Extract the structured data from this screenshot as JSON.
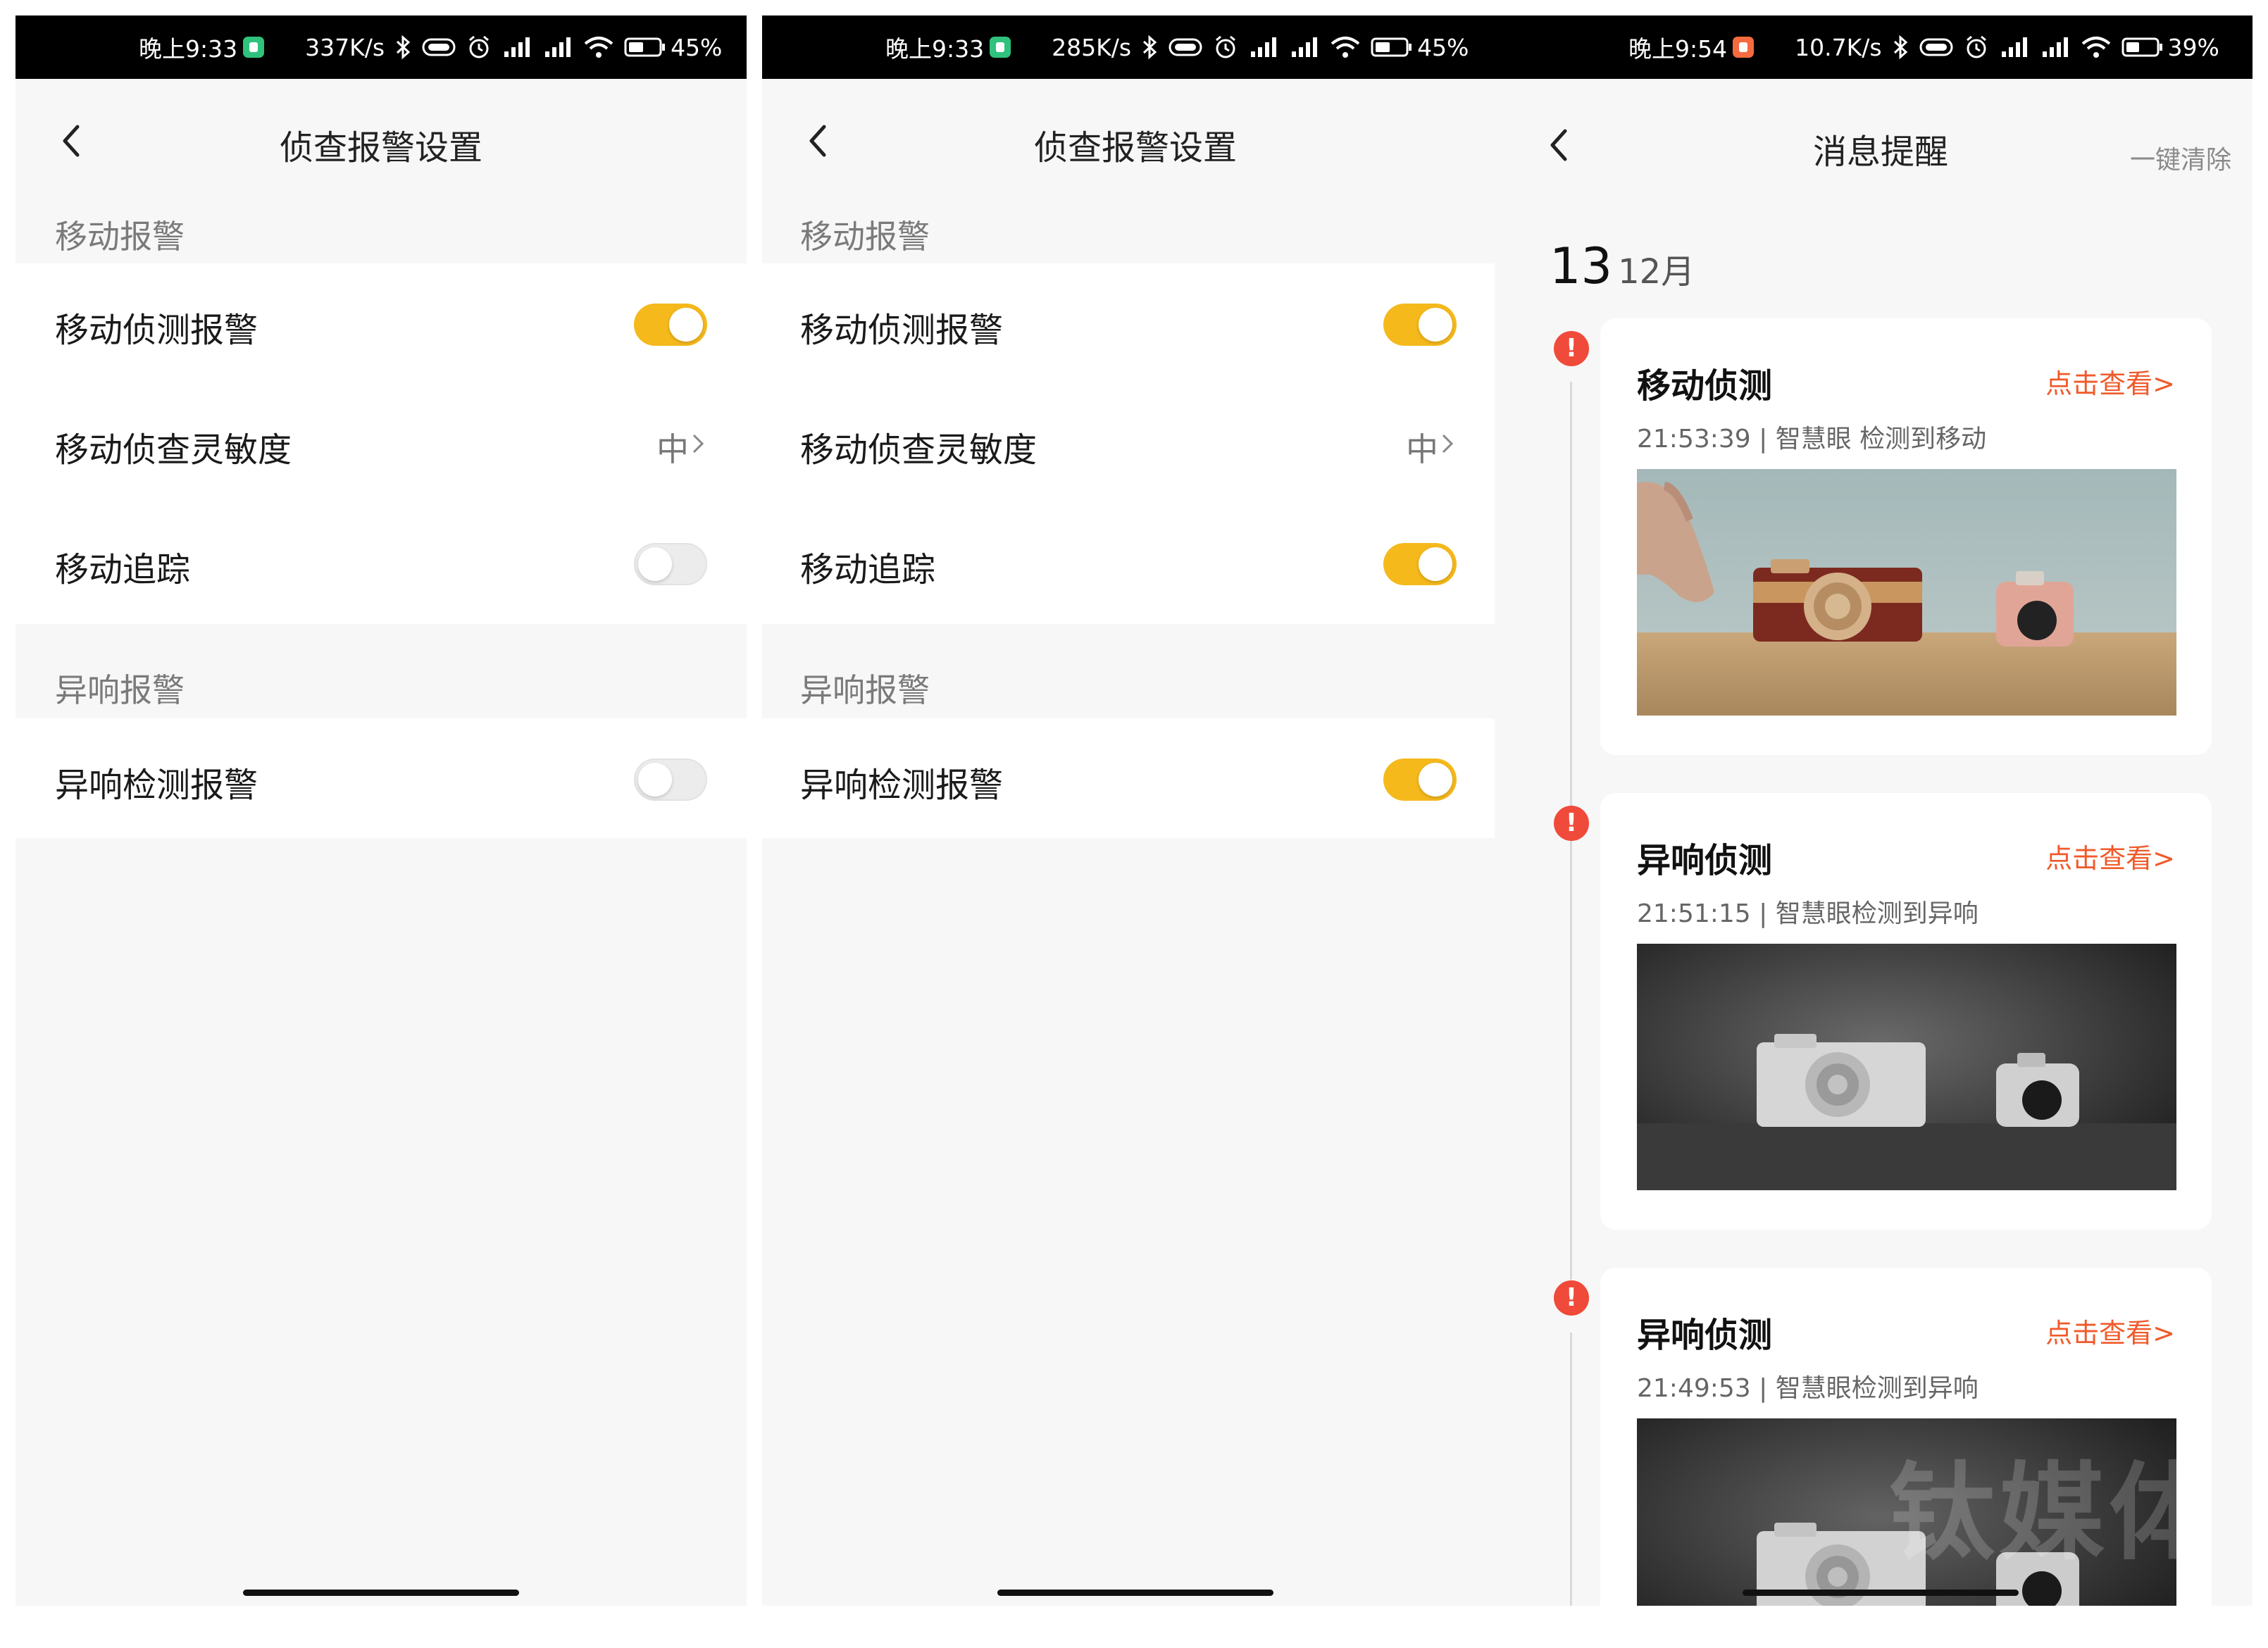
{
  "screens": [
    {
      "status": {
        "time": "晚上9:33",
        "speed": "337K/s",
        "battery": "45%"
      },
      "nav": {
        "title": "侦查报警设置"
      },
      "sections": [
        {
          "label": "移动报警",
          "rows": [
            {
              "label": "移动侦测报警",
              "toggle": "on"
            },
            {
              "label": "移动侦查灵敏度",
              "value": "中"
            },
            {
              "label": "移动追踪",
              "toggle": "off"
            }
          ]
        },
        {
          "label": "异响报警",
          "rows": [
            {
              "label": "异响检测报警",
              "toggle": "off"
            }
          ]
        }
      ]
    },
    {
      "status": {
        "time": "晚上9:33",
        "speed": "285K/s",
        "battery": "45%"
      },
      "nav": {
        "title": "侦查报警设置"
      },
      "sections": [
        {
          "label": "移动报警",
          "rows": [
            {
              "label": "移动侦测报警",
              "toggle": "on"
            },
            {
              "label": "移动侦查灵敏度",
              "value": "中"
            },
            {
              "label": "移动追踪",
              "toggle": "on"
            }
          ]
        },
        {
          "label": "异响报警",
          "rows": [
            {
              "label": "异响检测报警",
              "toggle": "on"
            }
          ]
        }
      ]
    },
    {
      "status": {
        "time": "晚上9:54",
        "speed": "10.7K/s",
        "battery": "39%"
      },
      "nav": {
        "title": "消息提醒",
        "clear": "一键清除"
      },
      "date": {
        "day": "13",
        "month": "12月"
      },
      "messages": [
        {
          "title": "移动侦测",
          "link": "点击查看>",
          "meta": "21:53:39 | 智慧眼 检测到移动",
          "thumb": "color-snapshot"
        },
        {
          "title": "异响侦测",
          "link": "点击查看>",
          "meta": "21:51:15 | 智慧眼检测到异响",
          "thumb": "night-snapshot"
        },
        {
          "title": "异响侦测",
          "link": "点击查看>",
          "meta": "21:49:53 | 智慧眼检测到异响",
          "thumb": "night-snapshot"
        }
      ],
      "watermark": "钛媒体"
    }
  ],
  "colors": {
    "accent_toggle": "#f5b91c",
    "alert": "#f04a3a",
    "link": "#f05a2a"
  },
  "icons": [
    "back-arrow-icon",
    "chevron-right-icon",
    "bluetooth-icon",
    "vibrate-icon",
    "alarm-icon",
    "signal-icon",
    "wifi-icon",
    "battery-icon",
    "alert-icon"
  ]
}
